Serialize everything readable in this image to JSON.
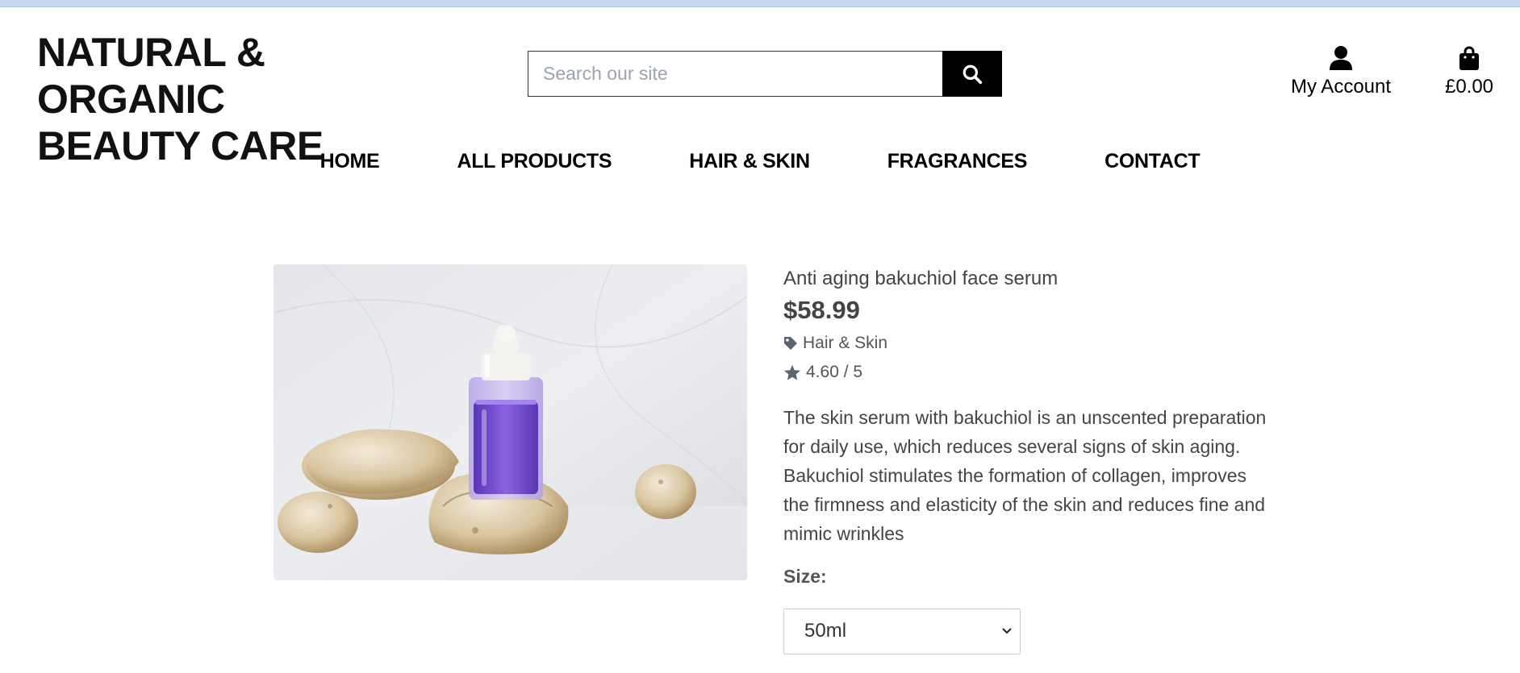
{
  "brand": {
    "line1": "NATURAL & ORGANIC",
    "line2": "BEAUTY CARE"
  },
  "search": {
    "placeholder": "Search our site",
    "icon": "search-icon"
  },
  "header": {
    "account_label": "My Account",
    "account_icon": "user-icon",
    "bag_total": "£0.00",
    "bag_icon": "shopping-bag-icon"
  },
  "nav": {
    "items": [
      {
        "label": "HOME"
      },
      {
        "label": "ALL PRODUCTS"
      },
      {
        "label": "HAIR & SKIN"
      },
      {
        "label": "FRAGRANCES"
      },
      {
        "label": "CONTACT"
      }
    ]
  },
  "product": {
    "image_icon": "serum-bottle-photo",
    "name": "Anti aging bakuchiol face serum",
    "price": "$58.99",
    "category": "Hair & Skin",
    "category_icon": "tag-icon",
    "rating": "4.60 / 5",
    "rating_icon": "star-icon",
    "description": "The skin serum with bakuchiol is an unscented preparation for daily use, which reduces several signs of skin aging. Bakuchiol stimulates the formation of collagen, improves the firmness and elasticity of the skin and reduces fine and mimic wrinkles",
    "size_label": "Size:",
    "size_selected": "50ml"
  },
  "colors": {
    "accent": "#000000",
    "text_muted": "#555555",
    "top_strip": "#c9d6ef"
  }
}
